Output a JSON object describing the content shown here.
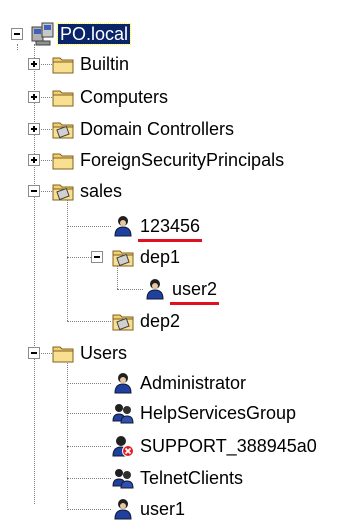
{
  "tree": {
    "root": {
      "label": "PO.local",
      "expanded": true,
      "selected": true,
      "icon": "domain-computer-icon"
    },
    "nodes": [
      {
        "label": "Builtin",
        "icon": "folder-icon",
        "expander": "plus"
      },
      {
        "label": "Computers",
        "icon": "folder-icon",
        "expander": "plus"
      },
      {
        "label": "Domain Controllers",
        "icon": "ou-folder-icon",
        "expander": "plus"
      },
      {
        "label": "ForeignSecurityPrincipals",
        "icon": "folder-icon",
        "expander": "plus"
      },
      {
        "label": "sales",
        "icon": "ou-folder-icon",
        "expander": "minus"
      },
      {
        "label": "123456",
        "icon": "user-icon",
        "underlined": true
      },
      {
        "label": "dep1",
        "icon": "ou-folder-icon",
        "expander": "minus"
      },
      {
        "label": "user2",
        "icon": "user-icon",
        "underlined": true
      },
      {
        "label": "dep2",
        "icon": "ou-folder-icon"
      },
      {
        "label": "Users",
        "icon": "folder-icon",
        "expander": "minus"
      },
      {
        "label": "Administrator",
        "icon": "user-icon"
      },
      {
        "label": "HelpServicesGroup",
        "icon": "group-icon"
      },
      {
        "label": "SUPPORT_388945a0",
        "icon": "disabled-user-icon"
      },
      {
        "label": "TelnetClients",
        "icon": "group-icon"
      },
      {
        "label": "user1",
        "icon": "user-icon"
      }
    ]
  },
  "colors": {
    "selection_bg": "#0a246a",
    "underline": "#e01020",
    "folder": "#f0d070"
  }
}
